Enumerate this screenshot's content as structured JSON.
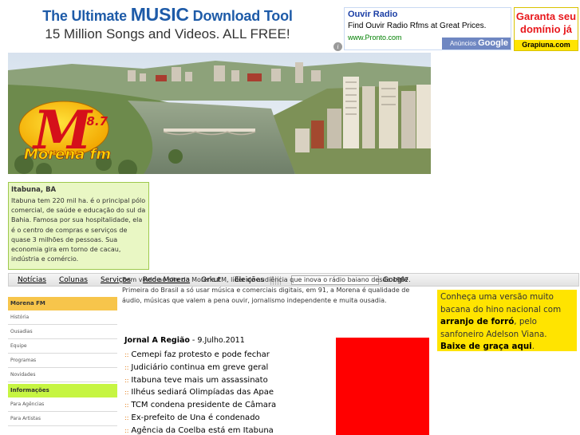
{
  "ads": {
    "music": {
      "line1_pre": "The Ultimate ",
      "line1_big": "MUSIC",
      "line1_post": " Download Tool",
      "line2": "15 Million Songs and Videos. ALL FREE!",
      "info_icon": "i"
    },
    "ouvir": {
      "title": "Ouvir Radio",
      "description": "Find Ouvir Radio Rfms at Great Prices.",
      "url": "www.Pronto.com",
      "badge_pre": "Anúncios",
      "badge_brand": "Google"
    },
    "garanta": {
      "line1": "Garanta seu",
      "line2": "domínio já",
      "site": "Grapiuna.com"
    }
  },
  "hero": {
    "logo_letter": "M",
    "logo_freq": "98.7",
    "logo_name": "Morena fm"
  },
  "city": {
    "title": "Itabuna, BA",
    "body": "Itabuna tem 220 mil ha. é o principal pólo comercial, de saúde e educação do sul da Bahia. Famosa por sua hospitalidade, ela é o centro de compras e serviços de quase 3 milhões de pessoas. Sua economia gira em torno de cacau, indústria e comércio."
  },
  "nav": {
    "items": [
      "Notícias",
      "Colunas",
      "Serviços",
      "Rede Morena",
      "Orkut",
      "Eleições"
    ],
    "search_button": "Google"
  },
  "sidebar": {
    "section1": "Morena FM",
    "section1_items": [
      "História",
      "Ousadias",
      "Equipe",
      "Programas",
      "Novidades"
    ],
    "section2": "Informações",
    "section2_items": [
      "Para Agências",
      "Para Artistas"
    ]
  },
  "main": {
    "intro": "Bem vindo ao site da Morena FM, líder de audiência que inova o rádio baiano desde 1987. Primeira do Brasil a só usar música e comerciais digitais, em 91, a Morena é qualidade de áudio, músicas que valem a pena ouvir, jornalismo independente e muita ousadia.",
    "news_title_bold": "Jornal A Região",
    "news_title_date": " - 9.Julho.2011",
    "bullet": "::",
    "news": [
      "Cemepi faz protesto e pode fechar",
      "Judiciário continua em greve geral",
      "Itabuna teve mais um assassinato",
      "Ilhéus sediará Olimpíadas das Apae",
      "TCM condena presidente de Câmara",
      "Ex-prefeito de Una é condenado",
      "Agência da Coelba está em Itabuna"
    ]
  },
  "promo": {
    "t1": "Conheça uma versão muito bacana do hino nacional com ",
    "b1": "arranjo de forró",
    "t2": ", pelo sanfoneiro Adelson Viana. ",
    "b2": "Baixe de graça aqui",
    "t3": "."
  },
  "colors": {
    "accent_blue": "#1e5ba8",
    "box_green": "#e9f7c4",
    "sidebar_orange": "#f7c54b",
    "sidebar_lime": "#c6f542",
    "promo_yellow": "#ffe400",
    "red_block": "#ff0000"
  }
}
